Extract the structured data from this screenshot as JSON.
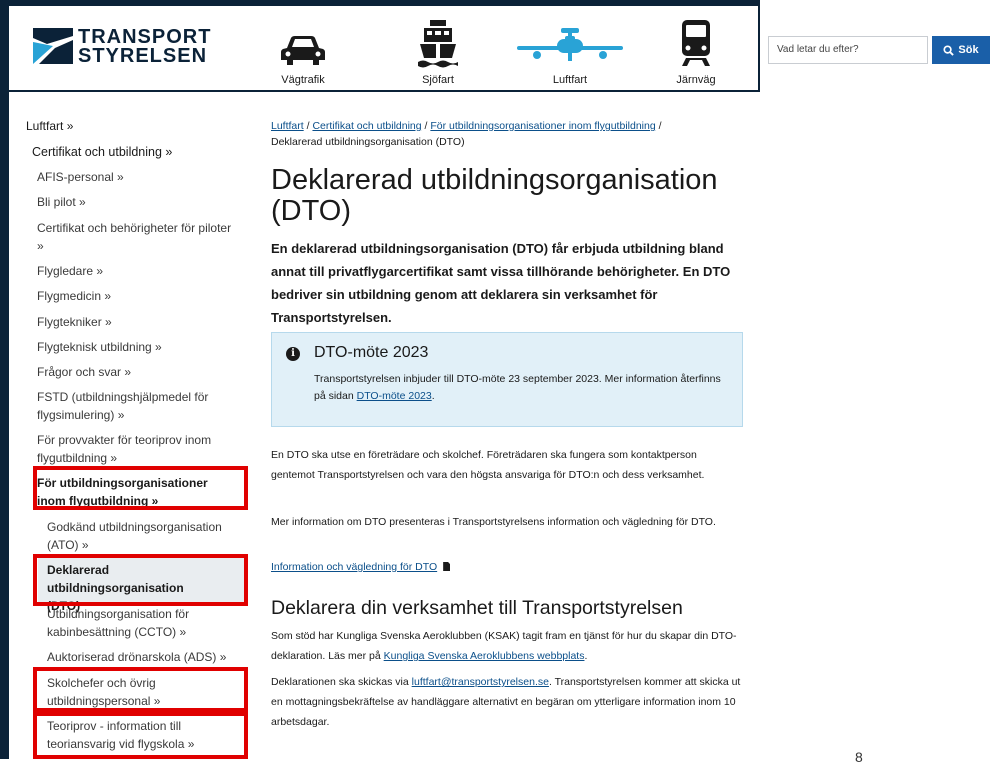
{
  "header": {
    "logo_line1": "TRANSPORT",
    "logo_line2": "STYRELSEN",
    "modes": [
      {
        "label": "Vägtrafik",
        "icon": "car-icon"
      },
      {
        "label": "Sjöfart",
        "icon": "ship-icon"
      },
      {
        "label": "Luftfart",
        "icon": "airplane-icon",
        "active": true
      },
      {
        "label": "Järnväg",
        "icon": "train-icon"
      }
    ],
    "search": {
      "placeholder": "Vad letar du efter?",
      "button": "Sök"
    }
  },
  "sidebar": {
    "root": "Luftfart »",
    "section": "Certifikat och utbildning »",
    "items": [
      "AFIS-personal »",
      "Bli pilot »",
      "Certifikat och behörigheter för piloter »",
      "Flygledare  »",
      "Flygmedicin »",
      "Flygtekniker »",
      "Flygteknisk utbildning »",
      "Frågor och svar »",
      "FSTD (utbildningshjälpmedel för flygsimulering) »",
      "För provvakter för teoriprov inom flygutbildning »",
      "För utbildningsorganisationer inom flygutbildning »"
    ],
    "subitems": [
      "Godkänd utbildningsorganisation (ATO) »",
      "Deklarerad utbildningsorganisation (DTO)",
      "Utbildningsorganisation för kabinbesättning (CCTO) »",
      "Auktoriserad drönarskola (ADS) »",
      "Skolchefer och övrig utbildningspersonal »",
      "Teoriprov - information till teoriansvarig vid flygskola »"
    ]
  },
  "breadcrumb": {
    "items": [
      "Luftfart",
      "Certifikat och utbildning",
      "För utbildningsorganisationer inom flygutbildning"
    ],
    "separator": "/",
    "current": "Deklarerad utbildningsorganisation (DTO)"
  },
  "main": {
    "title": "Deklarerad utbildningsorganisation (DTO)",
    "lead": "En deklarerad utbildningsorganisation (DTO) får erbjuda utbildning bland annat till privatflygarcertifikat samt vissa tillhörande behörigheter. En DTO bedriver sin utbildning genom att deklarera sin verksamhet för Transportstyrelsen.",
    "info": {
      "heading": "DTO-möte 2023",
      "text": "Transportstyrelsen inbjuder till DTO-möte 23 september 2023. Mer information återfinns på sidan ",
      "link": "DTO-möte 2023",
      "end": "."
    },
    "p1": "En DTO ska utse en företrädare och skolchef. Företrädaren ska fungera som kontaktperson gentemot Transportstyrelsen och vara den högsta ansvariga för DTO:n och dess verksamhet.",
    "p2": "Mer information om DTO presenteras i Transportstyrelsens information och vägledning för DTO.",
    "doc_link": "Information och vägledning för DTO",
    "h2": "Deklarera din verksamhet till Transportstyrelsen",
    "p3_a": "Som stöd har Kungliga Svenska Aeroklubben (KSAK) tagit fram en tjänst för hur du skapar din DTO-deklaration. Läs mer på ",
    "p3_link": "Kungliga Svenska Aeroklubbens webbplats",
    "p3_b": ".",
    "p4_a": "Deklarationen ska skickas via ",
    "p4_link": "luftfart@transportstyrelsen.se",
    "p4_b": ". Transportstyrelsen kommer att skicka ut en mottagningsbekräftelse av handläggare alternativt en begäran om ytterligare information inom 10 arbetsdagar."
  },
  "page_number": "8",
  "colors": {
    "navy": "#0b2238",
    "accent": "#29a3d6",
    "link": "#0b4f8a",
    "highlight": "#e00000",
    "info_bg": "#e1f0f8"
  }
}
